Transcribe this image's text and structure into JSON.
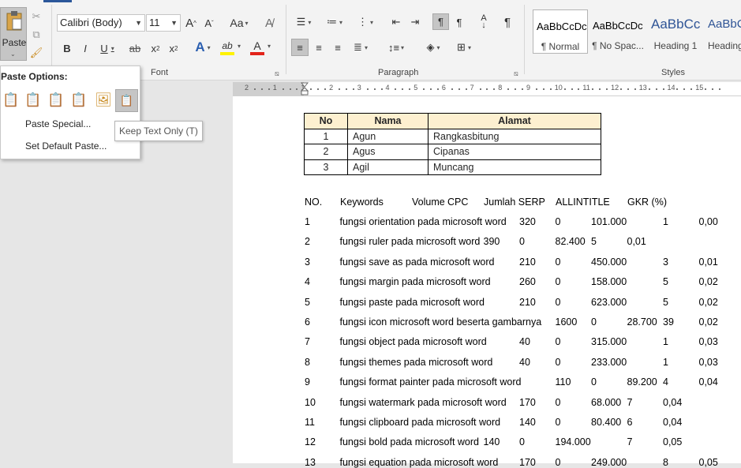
{
  "ribbon": {
    "clipboard": {
      "paste_label": "Paste"
    },
    "font": {
      "group_label": "Font",
      "font_name": "Calibri (Body)",
      "font_size": "11",
      "grow_label": "A",
      "shrink_label": "A",
      "change_case_label": "Aa",
      "bold_label": "B",
      "italic_label": "I",
      "underline_label": "U",
      "strike_label": "ab",
      "subscript_label": "x",
      "superscript_label": "x",
      "effects_label": "A",
      "highlight_label": "ab",
      "font_color_label": "A"
    },
    "paragraph": {
      "group_label": "Paragraph",
      "sort_label": "A",
      "pilcrow_label": "¶"
    },
    "styles": {
      "group_label": "Styles",
      "items": [
        {
          "preview": "AaBbCcDc",
          "name": "¶ Normal"
        },
        {
          "preview": "AaBbCcDc",
          "name": "¶ No Spac..."
        },
        {
          "preview": "AaBbCc",
          "name": "Heading 1"
        },
        {
          "preview": "AaBbC",
          "name": "Heading"
        }
      ]
    }
  },
  "ruler": {
    "numbers": [
      "2",
      "1",
      "1",
      "2",
      "3",
      "4",
      "5",
      "6",
      "7",
      "8",
      "9",
      "10",
      "11",
      "12",
      "13",
      "14",
      "15"
    ]
  },
  "paste_options": {
    "title": "Paste Options:",
    "special_label": "Paste Special...",
    "default_label": "Set Default Paste...",
    "tooltip": "Keep Text Only (T)"
  },
  "doc_table": {
    "headers": [
      "No",
      "Nama",
      "Alamat"
    ],
    "rows": [
      [
        "1",
        "Agun",
        "Rangkasbitung"
      ],
      [
        "2",
        "Agus",
        "Cipanas"
      ],
      [
        "3",
        "Agil",
        "Muncang"
      ]
    ]
  },
  "keyword_table": {
    "headers": [
      "NO.",
      "Keywords",
      "Volume",
      "CPC",
      "Jumlah SERP",
      "ALLINTITLE",
      "GKR (%)"
    ],
    "rows": [
      [
        "1",
        "fungsi orientation pada microsoft word",
        "320",
        "0",
        "101.000",
        "1",
        "0,00"
      ],
      [
        "2",
        "fungsi ruler pada microsoft word",
        "390",
        "0",
        "82.400",
        "5",
        "0,01"
      ],
      [
        "3",
        "fungsi save as pada microsoft word",
        "210",
        "0",
        "450.000",
        "3",
        "0,01"
      ],
      [
        "4",
        "fungsi margin pada microsoft word",
        "260",
        "0",
        "158.000",
        "5",
        "0,02"
      ],
      [
        "5",
        "fungsi paste pada microsoft word",
        "210",
        "0",
        "623.000",
        "5",
        "0,02"
      ],
      [
        "6",
        "fungsi icon microsoft word beserta gambarnya",
        "1600",
        "0",
        "28.700",
        "39",
        "0,02"
      ],
      [
        "7",
        "fungsi object pada microsoft word",
        "40",
        "0",
        "315.000",
        "1",
        "0,03"
      ],
      [
        "8",
        "fungsi themes pada microsoft word",
        "40",
        "0",
        "233.000",
        "1",
        "0,03"
      ],
      [
        "9",
        "fungsi format painter pada microsoft word",
        "110",
        "0",
        "89.200",
        "4",
        "0,04"
      ],
      [
        "10",
        "fungsi watermark pada microsoft word",
        "170",
        "0",
        "68.000",
        "7",
        "0,04"
      ],
      [
        "11",
        "fungsi clipboard pada microsoft word",
        "140",
        "0",
        "80.400",
        "6",
        "0,04"
      ],
      [
        "12",
        "fungsi bold pada microsoft word",
        "140",
        "0",
        "194.000",
        "7",
        "0,05"
      ],
      [
        "13",
        "fungsi equation pada microsoft word",
        "170",
        "0",
        "249.000",
        "8",
        "0,05"
      ]
    ]
  }
}
